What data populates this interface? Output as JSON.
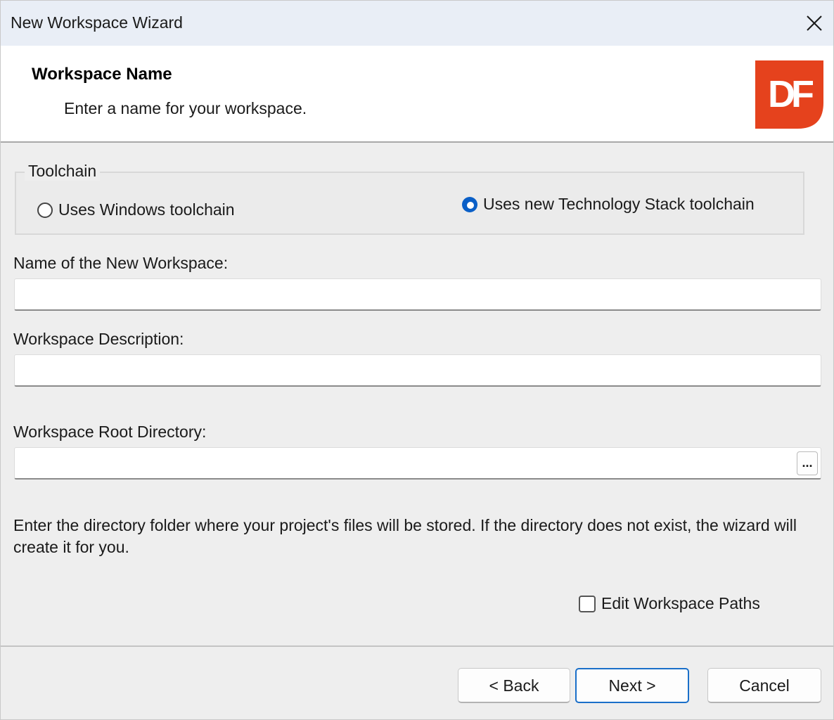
{
  "window": {
    "title": "New Workspace Wizard",
    "close_icon": "close-icon"
  },
  "header": {
    "title": "Workspace Name",
    "subtitle": "Enter a name for your workspace.",
    "logo_text": "DF",
    "logo_color": "#e5421d"
  },
  "toolchain": {
    "legend": "Toolchain",
    "options": [
      {
        "label": "Uses Windows toolchain",
        "selected": false
      },
      {
        "label": "Uses new Technology Stack toolchain",
        "selected": true
      }
    ]
  },
  "fields": {
    "name_label": "Name of the New Workspace:",
    "name_value": "",
    "description_label": "Workspace Description:",
    "description_value": "",
    "root_label": "Workspace Root Directory:",
    "root_value": "",
    "browse_label": "..."
  },
  "help_text": "Enter the directory folder where your project's files will be stored. If the directory does not exist, the wizard will create it for you.",
  "edit_paths": {
    "label": "Edit Workspace Paths",
    "checked": false
  },
  "buttons": {
    "back": "< Back",
    "next": "Next >",
    "cancel": "Cancel"
  },
  "colors": {
    "accent": "#0a5fc7",
    "titlebar": "#e9eef6"
  }
}
